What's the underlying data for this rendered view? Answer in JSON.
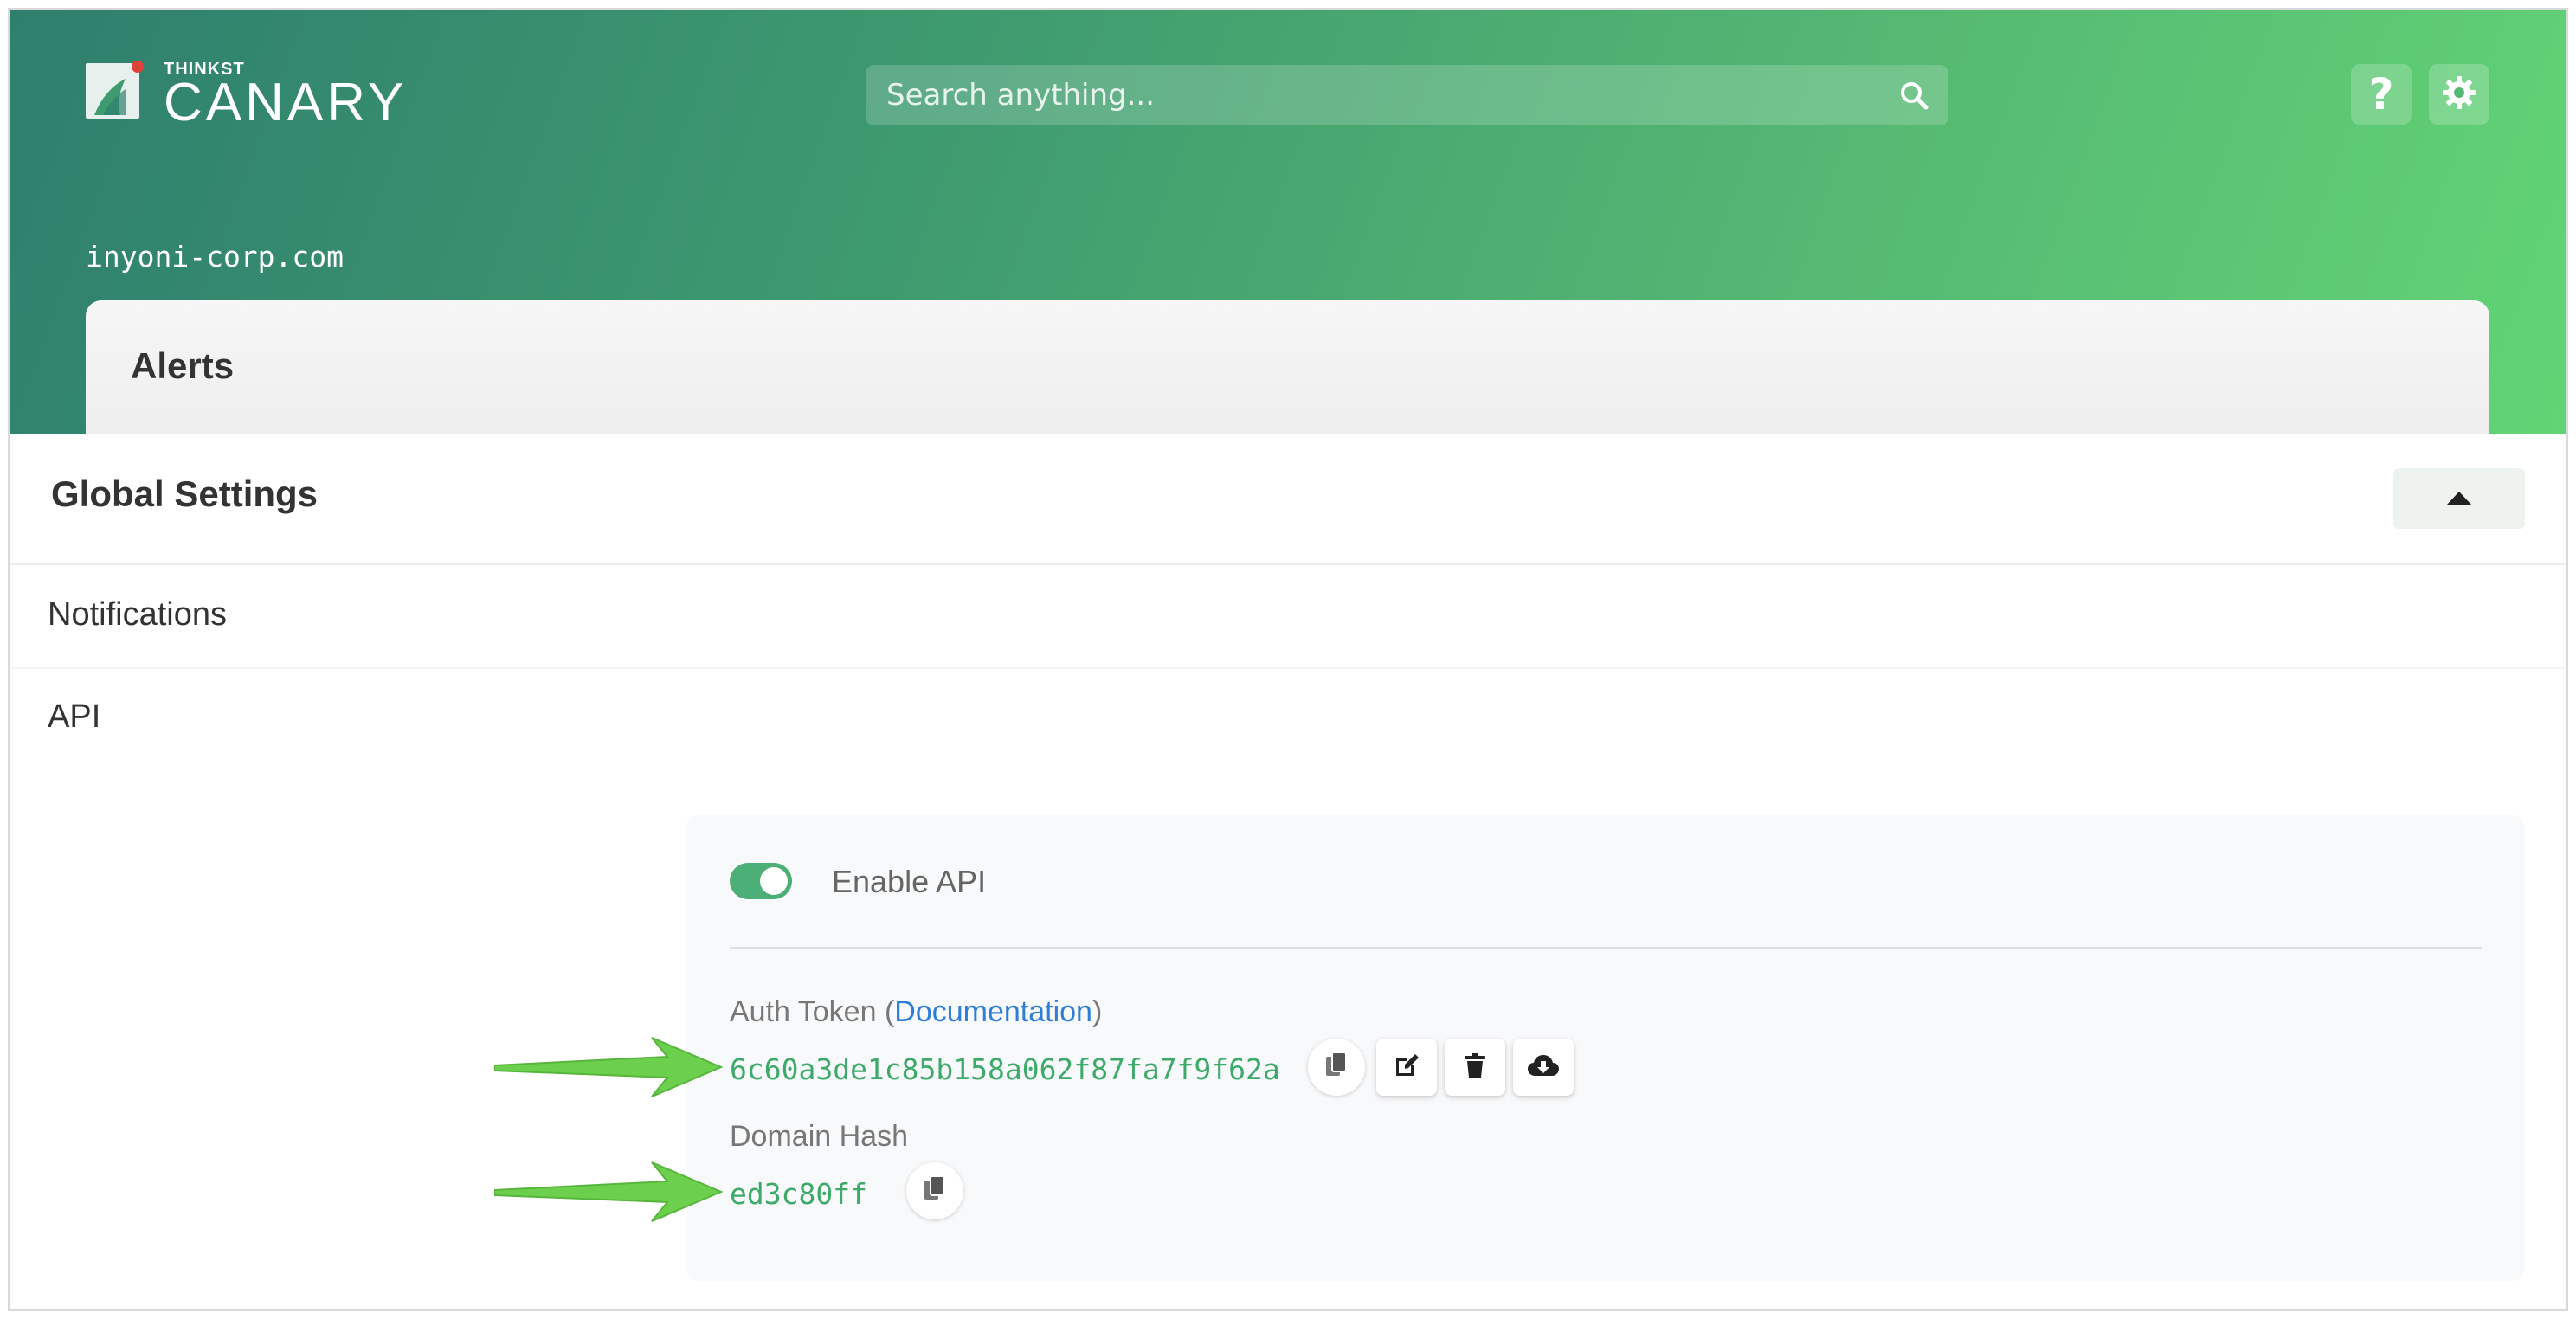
{
  "brand": {
    "small": "THINKST",
    "big": "CANARY",
    "colors": {
      "header_start": "#2f7f6e",
      "header_end": "#62d475",
      "accent_green": "#3daa6a",
      "link_blue": "#2e7dd6",
      "logo_dot": "#e0433a"
    }
  },
  "header": {
    "search_placeholder": "Search anything...",
    "help_icon": "question-icon",
    "settings_icon": "gear-icon"
  },
  "domain": "inyoni-corp.com",
  "alerts": {
    "title": "Alerts"
  },
  "global_settings": {
    "title": "Global Settings",
    "collapse_icon": "caret-up-icon"
  },
  "sections": {
    "notifications": "Notifications",
    "api": "API"
  },
  "api": {
    "enable_label": "Enable API",
    "enabled": true,
    "auth_token_label": "Auth Token (",
    "documentation_link": "Documentation",
    "auth_token_label_close": ")",
    "auth_token": "6c60a3de1c85b158a062f87fa7f9f62a",
    "domain_hash_label": "Domain Hash",
    "domain_hash": "ed3c80ff",
    "actions": [
      "copy-icon",
      "edit-icon",
      "trash-icon",
      "cloud-download-icon"
    ]
  }
}
